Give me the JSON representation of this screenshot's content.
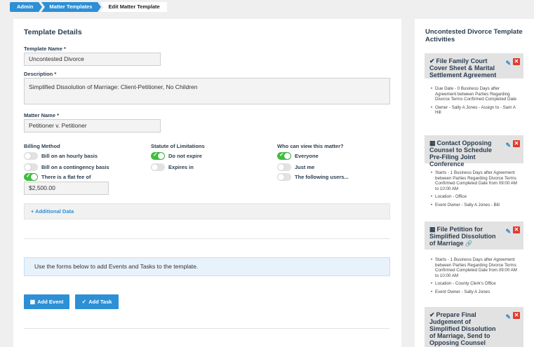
{
  "breadcrumb": [
    "Admin",
    "Matter Templates",
    "Edit Matter Template"
  ],
  "main": {
    "title": "Template Details",
    "template_name": {
      "label": "Template Name *",
      "value": "Uncontested Divorce"
    },
    "description": {
      "label": "Description *",
      "value": "Simplified Dissolution of Marriage:  Client-Petitioner, No Children"
    },
    "matter_name": {
      "label": "Matter Name *",
      "value": "Petitioner v. Petitioner"
    },
    "billing": {
      "label": "Billing Method",
      "options": [
        {
          "label": "Bill on an hourly basis",
          "on": false
        },
        {
          "label": "Bill on a contingency basis",
          "on": false
        },
        {
          "label": "There is a flat fee of",
          "on": true
        }
      ],
      "fee_value": "$2,500.00"
    },
    "statute": {
      "label": "Statute of Limitations",
      "options": [
        {
          "label": "Do not expire",
          "on": true
        },
        {
          "label": "Expires in",
          "on": false
        }
      ]
    },
    "visibility": {
      "label": "Who can view this matter?",
      "options": [
        {
          "label": "Everyone",
          "on": true
        },
        {
          "label": "Just me",
          "on": false
        },
        {
          "label": "The following users...",
          "on": false
        }
      ]
    },
    "additional_data": "+ Additional Data",
    "info_text": "Use the forms below to add Events and Tasks to the template.",
    "add_event": "Add Event",
    "add_task": "Add Task"
  },
  "sidebar": {
    "title": "Uncontested Divorce Template Activities",
    "activities": [
      {
        "icon": "check-icon",
        "title": "File Family Court Cover Sheet & Marital Settlement Agreement",
        "details": [
          "Due Date - 0 Business Days after Agreement between Parties Regarding Divorce Terms Confirmed Completed Date",
          "Owner - Sally A Jones - Assign to - Sam A Hill"
        ]
      },
      {
        "icon": "calendar-icon",
        "title": "Contact Opposing Counsel to Schedule Pre-Filing Joint Conference",
        "details": [
          "Starts - 1 Business Days after Agreement between Parties Regarding Divorce Terms Confirmed Completed Date from 09:00 AM to 10:00 AM",
          "Location - Office",
          "Event Owner - Sally A Jones - Bill"
        ]
      },
      {
        "icon": "calendar-icon",
        "title": "File Petition for Simplified Dissolution of Marriage",
        "details": [
          "Starts - 1 Business Days after Agreement between Parties Regarding Divorce Terms Confirmed Completed Date from 09:00 AM to 10:00 AM",
          "Location - County Clerk's Office",
          "Event Owner - Sally A Jones"
        ]
      },
      {
        "icon": "check-icon",
        "title": "Prepare Final Judgement of Simplified Dissolution of Marriage, Send to Opposing Counsel",
        "details": []
      }
    ]
  }
}
